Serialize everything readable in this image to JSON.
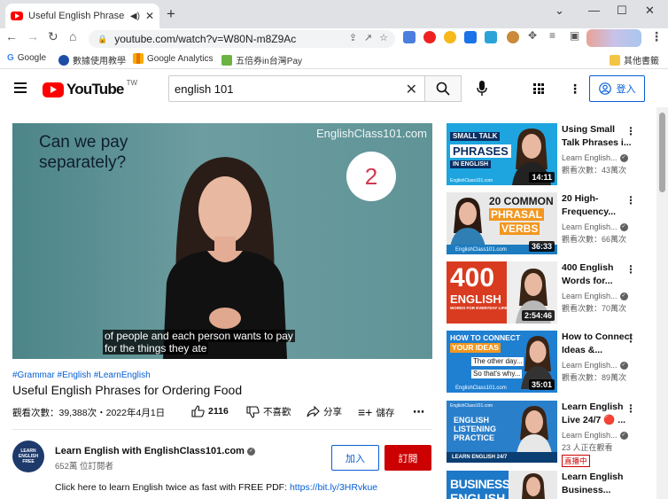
{
  "browser": {
    "tab_title": "Useful English Phrases for O",
    "url": "youtube.com/watch?v=W80N-m8Z9Ac",
    "bookmarks": [
      "Google",
      "數據使用教學",
      "Google Analytics",
      "五倍券in台灣Pay"
    ],
    "other_bookmarks": "其他書籤"
  },
  "youtube": {
    "logo_text": "YouTube",
    "logo_region": "TW",
    "search_value": "english 101",
    "signin_label": "登入"
  },
  "video": {
    "watermark": "EnglishClass101.com",
    "overlay_question_line1": "Can we pay",
    "overlay_question_line2": "separately?",
    "overlay_number": "2",
    "subtitle_line1": "of people and each person wants to pay",
    "subtitle_line2": "for the things they ate",
    "hashtags": "#Grammar #English #LearnEnglish",
    "title": "Useful English Phrases for Ordering Food",
    "views_date": "觀看次數：39,388次・2022年4月1日",
    "likes": "2116",
    "dislike_label": "不喜歡",
    "share_label": "分享",
    "save_label": "儲存",
    "channel_name": "Learn English with EnglishClass101.com",
    "channel_subs": "652萬 位訂閱者",
    "channel_avatar_text": "LEARN ENGLISH FREE",
    "join_label": "加入",
    "subscribe_label": "訂閱",
    "description_prefix": "Click here to learn English twice as fast with FREE PDF: ",
    "description_link": "https://bit.ly/3HRvkue"
  },
  "related": [
    {
      "title": "Using Small Talk Phrases i...",
      "channel": "Learn English...",
      "views": "觀看次數：43萬次",
      "duration": "14:11",
      "thumb_lines": [
        "SMALL TALK",
        "PHRASES",
        "IN ENGLISH"
      ]
    },
    {
      "title": "20 High-Frequency...",
      "channel": "Learn English...",
      "views": "觀看次數：66萬次",
      "duration": "36:33",
      "thumb_lines": [
        "20 COMMON",
        "PHRASAL",
        "VERBS"
      ]
    },
    {
      "title": "400 English Words for...",
      "channel": "Learn English...",
      "views": "觀看次數：70萬次",
      "duration": "2:54:46",
      "thumb_lines": [
        "400",
        "ENGLISH",
        "WORDS FOR EVERYDAY LIFE"
      ]
    },
    {
      "title": "How to Connect Ideas &...",
      "channel": "Learn English...",
      "views": "觀看次數：89萬次",
      "duration": "35:01",
      "thumb_lines": [
        "HOW TO CONNECT",
        "YOUR IDEAS",
        "The other day...",
        "So that's why..."
      ]
    },
    {
      "title": "Learn English Live 24/7 🔴 ...",
      "channel": "Learn English...",
      "views": "23 人正在觀看",
      "live_badge": "直播中",
      "thumb_lines": [
        "ENGLISH",
        "LISTENING",
        "PRACTICE",
        "LEARN ENGLISH 24/7"
      ]
    },
    {
      "title": "Learn English Business...",
      "thumb_lines": [
        "BUSINESS",
        "ENGLISH"
      ]
    }
  ],
  "thumb_footer": "EnglishClass101.com"
}
